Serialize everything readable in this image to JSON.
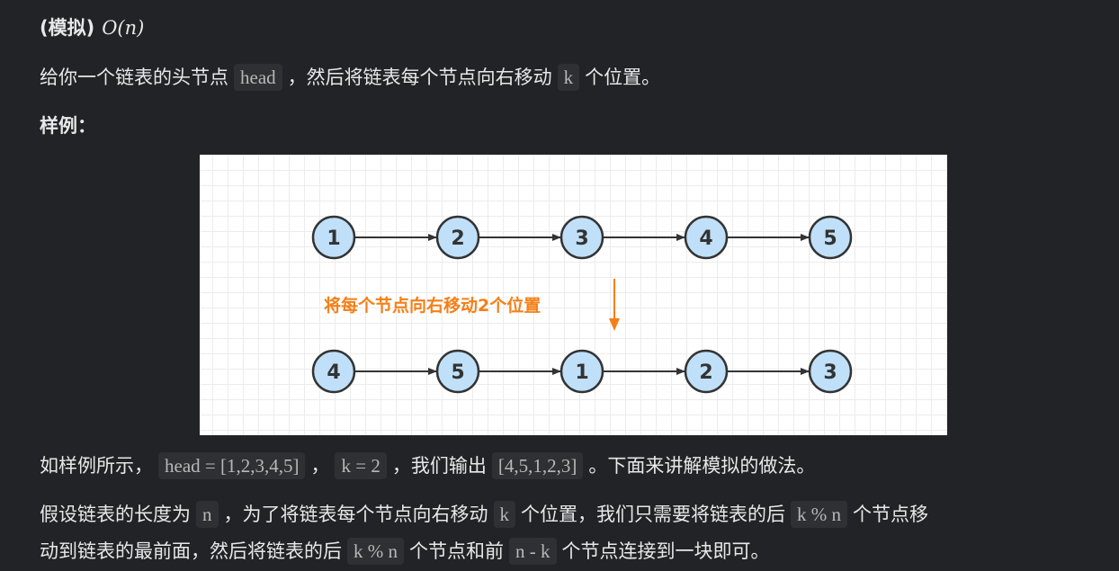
{
  "heading": {
    "label": "(模拟)",
    "complexity": "O(n)"
  },
  "intro": {
    "pre": "给你一个链表的头节点",
    "code1": "head",
    "mid": "，然后将链表每个节点向右移动",
    "code2": "k",
    "post": "个位置。"
  },
  "example_label": "样例：",
  "figure": {
    "top_row": [
      "1",
      "2",
      "3",
      "4",
      "5"
    ],
    "bottom_row": [
      "4",
      "5",
      "1",
      "2",
      "3"
    ],
    "annotation": "将每个节点向右移动2个位置",
    "node_fill": "#bfe0f8",
    "node_stroke": "#333333",
    "annotation_color": "#f57f17"
  },
  "para1": {
    "pre": "如样例所示，",
    "code1": "head = [1,2,3,4,5]",
    "sep": "，",
    "code2": "k = 2",
    "mid": "，我们输出",
    "code3": "[4,5,1,2,3]",
    "post": "。下面来讲解模拟的做法。"
  },
  "para2": {
    "l1_pre": "假设链表的长度为",
    "l1_code1": "n",
    "l1_mid": "，为了将链表每个节点向右移动",
    "l1_code2": "k",
    "l1_mid2": "个位置，我们只需要将链表的后",
    "l1_code3": "k % n",
    "l1_post": "个节点移",
    "l2_pre": "动到链表的最前面，然后将链表的后",
    "l2_code1": "k % n",
    "l2_mid": "个节点和前",
    "l2_code2": "n - k",
    "l2_post": "个节点连接到一块即可。"
  }
}
